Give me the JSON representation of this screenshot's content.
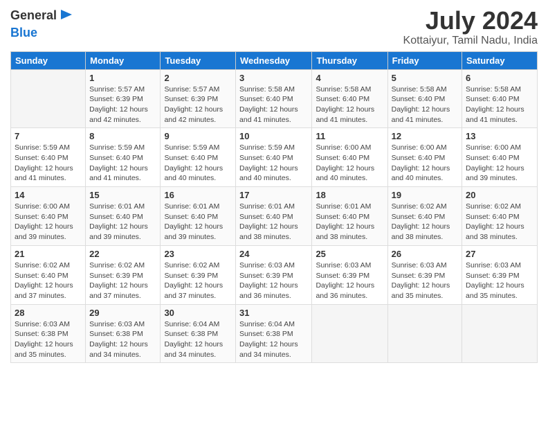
{
  "logo": {
    "line1": "General",
    "line2": "Blue",
    "icon": "▶"
  },
  "title": "July 2024",
  "subtitle": "Kottaiyur, Tamil Nadu, India",
  "header": {
    "days": [
      "Sunday",
      "Monday",
      "Tuesday",
      "Wednesday",
      "Thursday",
      "Friday",
      "Saturday"
    ]
  },
  "weeks": [
    [
      {
        "num": "",
        "detail": ""
      },
      {
        "num": "1",
        "detail": "Sunrise: 5:57 AM\nSunset: 6:39 PM\nDaylight: 12 hours\nand 42 minutes."
      },
      {
        "num": "2",
        "detail": "Sunrise: 5:57 AM\nSunset: 6:39 PM\nDaylight: 12 hours\nand 42 minutes."
      },
      {
        "num": "3",
        "detail": "Sunrise: 5:58 AM\nSunset: 6:40 PM\nDaylight: 12 hours\nand 41 minutes."
      },
      {
        "num": "4",
        "detail": "Sunrise: 5:58 AM\nSunset: 6:40 PM\nDaylight: 12 hours\nand 41 minutes."
      },
      {
        "num": "5",
        "detail": "Sunrise: 5:58 AM\nSunset: 6:40 PM\nDaylight: 12 hours\nand 41 minutes."
      },
      {
        "num": "6",
        "detail": "Sunrise: 5:58 AM\nSunset: 6:40 PM\nDaylight: 12 hours\nand 41 minutes."
      }
    ],
    [
      {
        "num": "7",
        "detail": "Sunrise: 5:59 AM\nSunset: 6:40 PM\nDaylight: 12 hours\nand 41 minutes."
      },
      {
        "num": "8",
        "detail": "Sunrise: 5:59 AM\nSunset: 6:40 PM\nDaylight: 12 hours\nand 41 minutes."
      },
      {
        "num": "9",
        "detail": "Sunrise: 5:59 AM\nSunset: 6:40 PM\nDaylight: 12 hours\nand 40 minutes."
      },
      {
        "num": "10",
        "detail": "Sunrise: 5:59 AM\nSunset: 6:40 PM\nDaylight: 12 hours\nand 40 minutes."
      },
      {
        "num": "11",
        "detail": "Sunrise: 6:00 AM\nSunset: 6:40 PM\nDaylight: 12 hours\nand 40 minutes."
      },
      {
        "num": "12",
        "detail": "Sunrise: 6:00 AM\nSunset: 6:40 PM\nDaylight: 12 hours\nand 40 minutes."
      },
      {
        "num": "13",
        "detail": "Sunrise: 6:00 AM\nSunset: 6:40 PM\nDaylight: 12 hours\nand 39 minutes."
      }
    ],
    [
      {
        "num": "14",
        "detail": "Sunrise: 6:00 AM\nSunset: 6:40 PM\nDaylight: 12 hours\nand 39 minutes."
      },
      {
        "num": "15",
        "detail": "Sunrise: 6:01 AM\nSunset: 6:40 PM\nDaylight: 12 hours\nand 39 minutes."
      },
      {
        "num": "16",
        "detail": "Sunrise: 6:01 AM\nSunset: 6:40 PM\nDaylight: 12 hours\nand 39 minutes."
      },
      {
        "num": "17",
        "detail": "Sunrise: 6:01 AM\nSunset: 6:40 PM\nDaylight: 12 hours\nand 38 minutes."
      },
      {
        "num": "18",
        "detail": "Sunrise: 6:01 AM\nSunset: 6:40 PM\nDaylight: 12 hours\nand 38 minutes."
      },
      {
        "num": "19",
        "detail": "Sunrise: 6:02 AM\nSunset: 6:40 PM\nDaylight: 12 hours\nand 38 minutes."
      },
      {
        "num": "20",
        "detail": "Sunrise: 6:02 AM\nSunset: 6:40 PM\nDaylight: 12 hours\nand 38 minutes."
      }
    ],
    [
      {
        "num": "21",
        "detail": "Sunrise: 6:02 AM\nSunset: 6:40 PM\nDaylight: 12 hours\nand 37 minutes."
      },
      {
        "num": "22",
        "detail": "Sunrise: 6:02 AM\nSunset: 6:39 PM\nDaylight: 12 hours\nand 37 minutes."
      },
      {
        "num": "23",
        "detail": "Sunrise: 6:02 AM\nSunset: 6:39 PM\nDaylight: 12 hours\nand 37 minutes."
      },
      {
        "num": "24",
        "detail": "Sunrise: 6:03 AM\nSunset: 6:39 PM\nDaylight: 12 hours\nand 36 minutes."
      },
      {
        "num": "25",
        "detail": "Sunrise: 6:03 AM\nSunset: 6:39 PM\nDaylight: 12 hours\nand 36 minutes."
      },
      {
        "num": "26",
        "detail": "Sunrise: 6:03 AM\nSunset: 6:39 PM\nDaylight: 12 hours\nand 35 minutes."
      },
      {
        "num": "27",
        "detail": "Sunrise: 6:03 AM\nSunset: 6:39 PM\nDaylight: 12 hours\nand 35 minutes."
      }
    ],
    [
      {
        "num": "28",
        "detail": "Sunrise: 6:03 AM\nSunset: 6:38 PM\nDaylight: 12 hours\nand 35 minutes."
      },
      {
        "num": "29",
        "detail": "Sunrise: 6:03 AM\nSunset: 6:38 PM\nDaylight: 12 hours\nand 34 minutes."
      },
      {
        "num": "30",
        "detail": "Sunrise: 6:04 AM\nSunset: 6:38 PM\nDaylight: 12 hours\nand 34 minutes."
      },
      {
        "num": "31",
        "detail": "Sunrise: 6:04 AM\nSunset: 6:38 PM\nDaylight: 12 hours\nand 34 minutes."
      },
      {
        "num": "",
        "detail": ""
      },
      {
        "num": "",
        "detail": ""
      },
      {
        "num": "",
        "detail": ""
      }
    ]
  ]
}
